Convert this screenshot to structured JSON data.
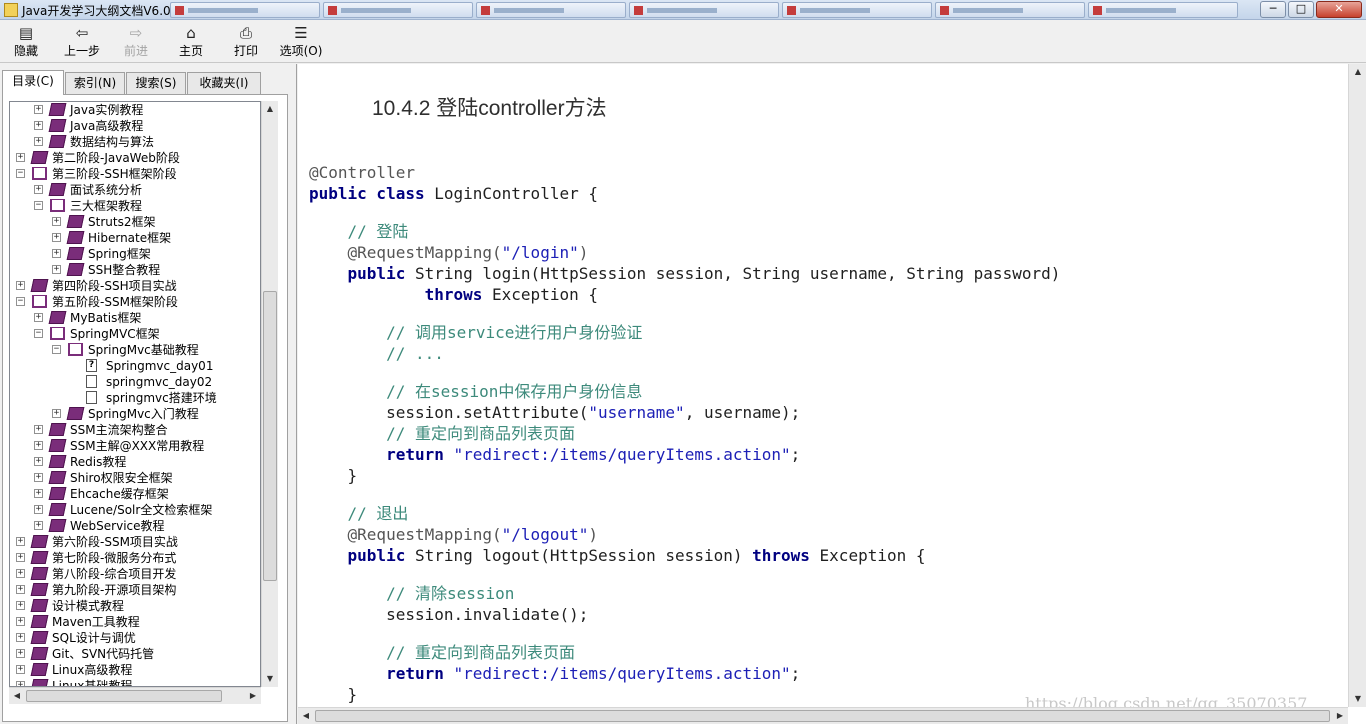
{
  "window": {
    "title": "Java开发学习大纲文档V6.0",
    "min_label": "─",
    "max_label": "□",
    "close_label": "✕"
  },
  "toolbar": {
    "hide": "隐藏",
    "back": "上一步",
    "forward": "前进",
    "home": "主页",
    "print": "打印",
    "options": "选项(O)"
  },
  "tabs": {
    "contents": "目录(C)",
    "index": "索引(N)",
    "search": "搜索(S)",
    "favorites": "收藏夹(I)"
  },
  "tree": [
    {
      "label": "Java实例教程",
      "level": 1,
      "icon": "book-closed",
      "expander": "+"
    },
    {
      "label": "Java高级教程",
      "level": 1,
      "icon": "book-closed",
      "expander": "+"
    },
    {
      "label": "数据结构与算法",
      "level": 1,
      "icon": "book-closed",
      "expander": "+"
    },
    {
      "label": "第二阶段-JavaWeb阶段",
      "level": 0,
      "icon": "book-closed",
      "expander": "+"
    },
    {
      "label": "第三阶段-SSH框架阶段",
      "level": 0,
      "icon": "book-open",
      "expander": "−"
    },
    {
      "label": "面试系统分析",
      "level": 1,
      "icon": "book-closed",
      "expander": "+"
    },
    {
      "label": "三大框架教程",
      "level": 1,
      "icon": "book-open",
      "expander": "−"
    },
    {
      "label": "Struts2框架",
      "level": 2,
      "icon": "book-closed",
      "expander": "+"
    },
    {
      "label": "Hibernate框架",
      "level": 2,
      "icon": "book-closed",
      "expander": "+"
    },
    {
      "label": "Spring框架",
      "level": 2,
      "icon": "book-closed",
      "expander": "+"
    },
    {
      "label": "SSH整合教程",
      "level": 2,
      "icon": "book-closed",
      "expander": "+"
    },
    {
      "label": "第四阶段-SSH项目实战",
      "level": 0,
      "icon": "book-closed",
      "expander": "+"
    },
    {
      "label": "第五阶段-SSM框架阶段",
      "level": 0,
      "icon": "book-open",
      "expander": "−"
    },
    {
      "label": "MyBatis框架",
      "level": 1,
      "icon": "book-closed",
      "expander": "+"
    },
    {
      "label": "SpringMVC框架",
      "level": 1,
      "icon": "book-open",
      "expander": "−"
    },
    {
      "label": "SpringMvc基础教程",
      "level": 2,
      "icon": "book-open",
      "expander": "−"
    },
    {
      "label": "Springmvc_day01",
      "level": 3,
      "icon": "help-page",
      "expander": ""
    },
    {
      "label": "springmvc_day02",
      "level": 3,
      "icon": "page",
      "expander": ""
    },
    {
      "label": "springmvc搭建环境",
      "level": 3,
      "icon": "page",
      "expander": ""
    },
    {
      "label": "SpringMvc入门教程",
      "level": 2,
      "icon": "book-closed",
      "expander": "+"
    },
    {
      "label": "SSM主流架构整合",
      "level": 1,
      "icon": "book-closed",
      "expander": "+"
    },
    {
      "label": "SSM主解@XXX常用教程",
      "level": 1,
      "icon": "book-closed",
      "expander": "+"
    },
    {
      "label": "Redis教程",
      "level": 1,
      "icon": "book-closed",
      "expander": "+"
    },
    {
      "label": "Shiro权限安全框架",
      "level": 1,
      "icon": "book-closed",
      "expander": "+"
    },
    {
      "label": "Ehcache缓存框架",
      "level": 1,
      "icon": "book-closed",
      "expander": "+"
    },
    {
      "label": "Lucene/Solr全文检索框架",
      "level": 1,
      "icon": "book-closed",
      "expander": "+"
    },
    {
      "label": "WebService教程",
      "level": 1,
      "icon": "book-closed",
      "expander": "+"
    },
    {
      "label": "第六阶段-SSM项目实战",
      "level": 0,
      "icon": "book-closed",
      "expander": "+"
    },
    {
      "label": "第七阶段-微服务分布式",
      "level": 0,
      "icon": "book-closed",
      "expander": "+"
    },
    {
      "label": "第八阶段-综合项目开发",
      "level": 0,
      "icon": "book-closed",
      "expander": "+"
    },
    {
      "label": "第九阶段-开源项目架构",
      "level": 0,
      "icon": "book-closed",
      "expander": "+"
    },
    {
      "label": "设计模式教程",
      "level": 0,
      "icon": "book-closed",
      "expander": "+"
    },
    {
      "label": "Maven工具教程",
      "level": 0,
      "icon": "book-closed",
      "expander": "+"
    },
    {
      "label": "SQL设计与调优",
      "level": 0,
      "icon": "book-closed",
      "expander": "+"
    },
    {
      "label": "Git、SVN代码托管",
      "level": 0,
      "icon": "book-closed",
      "expander": "+"
    },
    {
      "label": "Linux高级教程",
      "level": 0,
      "icon": "book-closed",
      "expander": "+"
    },
    {
      "label": "Linux基础教程",
      "level": 0,
      "icon": "book-closed",
      "expander": "+"
    }
  ],
  "content": {
    "heading": "10.4.2 登陆controller方法",
    "code": [
      [
        [
          "an",
          "@Controller"
        ]
      ],
      [
        [
          "kw",
          "public class"
        ],
        [
          "t",
          " LoginController {"
        ]
      ],
      [],
      [
        [
          "t",
          "    "
        ],
        [
          "cm",
          "// 登陆"
        ]
      ],
      [
        [
          "t",
          "    "
        ],
        [
          "an",
          "@RequestMapping("
        ],
        [
          "st",
          "\"/login\""
        ],
        [
          "an",
          ")"
        ]
      ],
      [
        [
          "t",
          "    "
        ],
        [
          "kw",
          "public"
        ],
        [
          "t",
          " String login(HttpSession session, String username, String password)"
        ]
      ],
      [
        [
          "t",
          "            "
        ],
        [
          "kw",
          "throws"
        ],
        [
          "t",
          " Exception {"
        ]
      ],
      [],
      [
        [
          "t",
          "        "
        ],
        [
          "cm",
          "// 调用service进行用户身份验证"
        ]
      ],
      [
        [
          "t",
          "        "
        ],
        [
          "cm",
          "// ..."
        ]
      ],
      [],
      [
        [
          "t",
          "        "
        ],
        [
          "cm",
          "// 在session中保存用户身份信息"
        ]
      ],
      [
        [
          "t",
          "        session.setAttribute("
        ],
        [
          "st",
          "\"username\""
        ],
        [
          "t",
          ", username);"
        ]
      ],
      [
        [
          "t",
          "        "
        ],
        [
          "cm",
          "// 重定向到商品列表页面"
        ]
      ],
      [
        [
          "t",
          "        "
        ],
        [
          "kw",
          "return"
        ],
        [
          "t",
          " "
        ],
        [
          "st",
          "\"redirect:/items/queryItems.action\""
        ],
        [
          "t",
          ";"
        ]
      ],
      [
        [
          "t",
          "    }"
        ]
      ],
      [],
      [
        [
          "t",
          "    "
        ],
        [
          "cm",
          "// 退出"
        ]
      ],
      [
        [
          "t",
          "    "
        ],
        [
          "an",
          "@RequestMapping("
        ],
        [
          "st",
          "\"/logout\""
        ],
        [
          "an",
          ")"
        ]
      ],
      [
        [
          "t",
          "    "
        ],
        [
          "kw",
          "public"
        ],
        [
          "t",
          " String logout(HttpSession session) "
        ],
        [
          "kw",
          "throws"
        ],
        [
          "t",
          " Exception {"
        ]
      ],
      [],
      [
        [
          "t",
          "        "
        ],
        [
          "cm",
          "// 清除session"
        ]
      ],
      [
        [
          "t",
          "        session.invalidate();"
        ]
      ],
      [],
      [
        [
          "t",
          "        "
        ],
        [
          "cm",
          "// 重定向到商品列表页面"
        ]
      ],
      [
        [
          "t",
          "        "
        ],
        [
          "kw",
          "return"
        ],
        [
          "t",
          " "
        ],
        [
          "st",
          "\"redirect:/items/queryItems.action\""
        ],
        [
          "t",
          ";"
        ]
      ],
      [
        [
          "t",
          "    }"
        ]
      ]
    ],
    "watermark": "https://blog.csdn.net/qq_35070357"
  }
}
